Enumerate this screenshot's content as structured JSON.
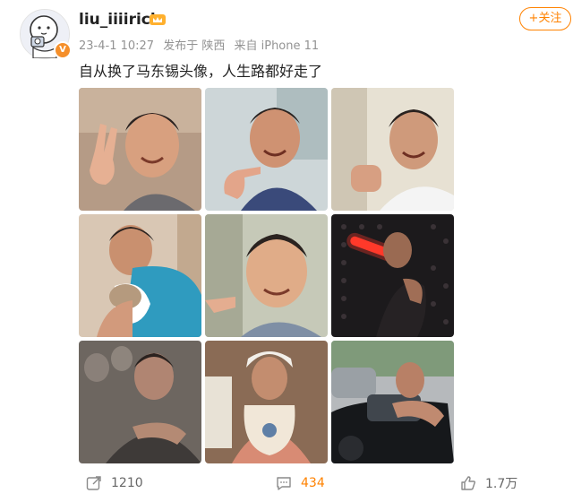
{
  "post": {
    "username": "liu_iiiirich",
    "timestamp": "23-4-1 10:27",
    "posted_from": "发布于 陕西",
    "device": "来自 iPhone 11",
    "text": "自从换了马东锡头像，人生路都好走了",
    "follow_label": "+关注",
    "verified_badge": "V"
  },
  "photos": [
    {
      "id": 1,
      "scene": "peace-sign",
      "bg": "#b59b86"
    },
    {
      "id": 2,
      "scene": "pointing",
      "bg": "#cdd6d8"
    },
    {
      "id": 3,
      "scene": "fist",
      "bg": "#e7e1d3"
    },
    {
      "id": 4,
      "scene": "holding-cat",
      "bg": "#d9c7b4"
    },
    {
      "id": 5,
      "scene": "selfie",
      "bg": "#c6c9b8"
    },
    {
      "id": 6,
      "scene": "glowstick",
      "bg": "#1c1a1c"
    },
    {
      "id": 7,
      "scene": "dark-scene",
      "bg": "#6d6660"
    },
    {
      "id": 8,
      "scene": "baby-bib",
      "bg": "#8a6b55"
    },
    {
      "id": 9,
      "scene": "car",
      "bg": "#b6b9bc"
    }
  ],
  "actions": {
    "reposts": "1210",
    "comments": "434",
    "likes": "1.7万"
  },
  "colors": {
    "accent": "#ff8200",
    "meta_gray": "#939393"
  },
  "icons": {
    "repost": "repost-icon",
    "comment": "comment-icon",
    "like": "thumbs-up-icon",
    "crown": "crown-icon"
  }
}
